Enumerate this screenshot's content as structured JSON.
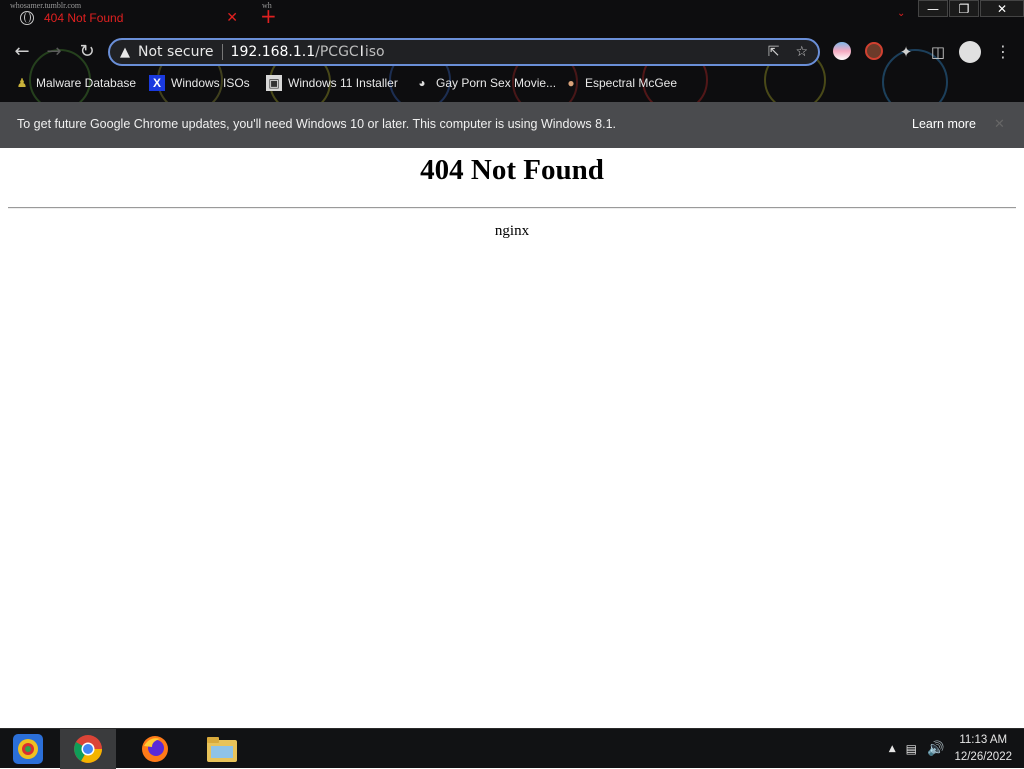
{
  "tab": {
    "title": "404 Not Found",
    "close_glyph": "✕",
    "new_tab_glyph": "+",
    "faint_label": "whosamer.tumblr.com",
    "faint_label_2": "wh"
  },
  "window": {
    "minimize": "—",
    "restore": "❐",
    "close": "✕",
    "tab_search": "⌄"
  },
  "omnibox": {
    "security_label": "Not secure",
    "url_host": "192.168.1.1",
    "url_path_before": "/PCGC",
    "url_path_after": "iso"
  },
  "bookmarks": [
    {
      "label": "Malware Database",
      "icon": "person-icon"
    },
    {
      "label": "Windows ISOs",
      "icon": "x-icon"
    },
    {
      "label": "Windows 11 Installer",
      "icon": "image-icon"
    },
    {
      "label": "Gay Porn Sex Movie...",
      "icon": "site-icon"
    },
    {
      "label": "Espectral McGee",
      "icon": "avatar-icon"
    }
  ],
  "infobar": {
    "message": "To get future Google Chrome updates, you'll need Windows 10 or later. This computer is using Windows 8.1.",
    "learn_more": "Learn more",
    "close": "✕"
  },
  "page": {
    "heading": "404 Not Found",
    "server": "nginx"
  },
  "taskbar": {
    "time": "11:13 AM",
    "date": "12/26/2022",
    "tray_chevron": "▲"
  },
  "colors": {
    "tab_title": "#e02020",
    "omnibox_border": "#6a8fd8",
    "infobar_bg": "#4a4b4e",
    "taskbar_bg": "#111214"
  }
}
